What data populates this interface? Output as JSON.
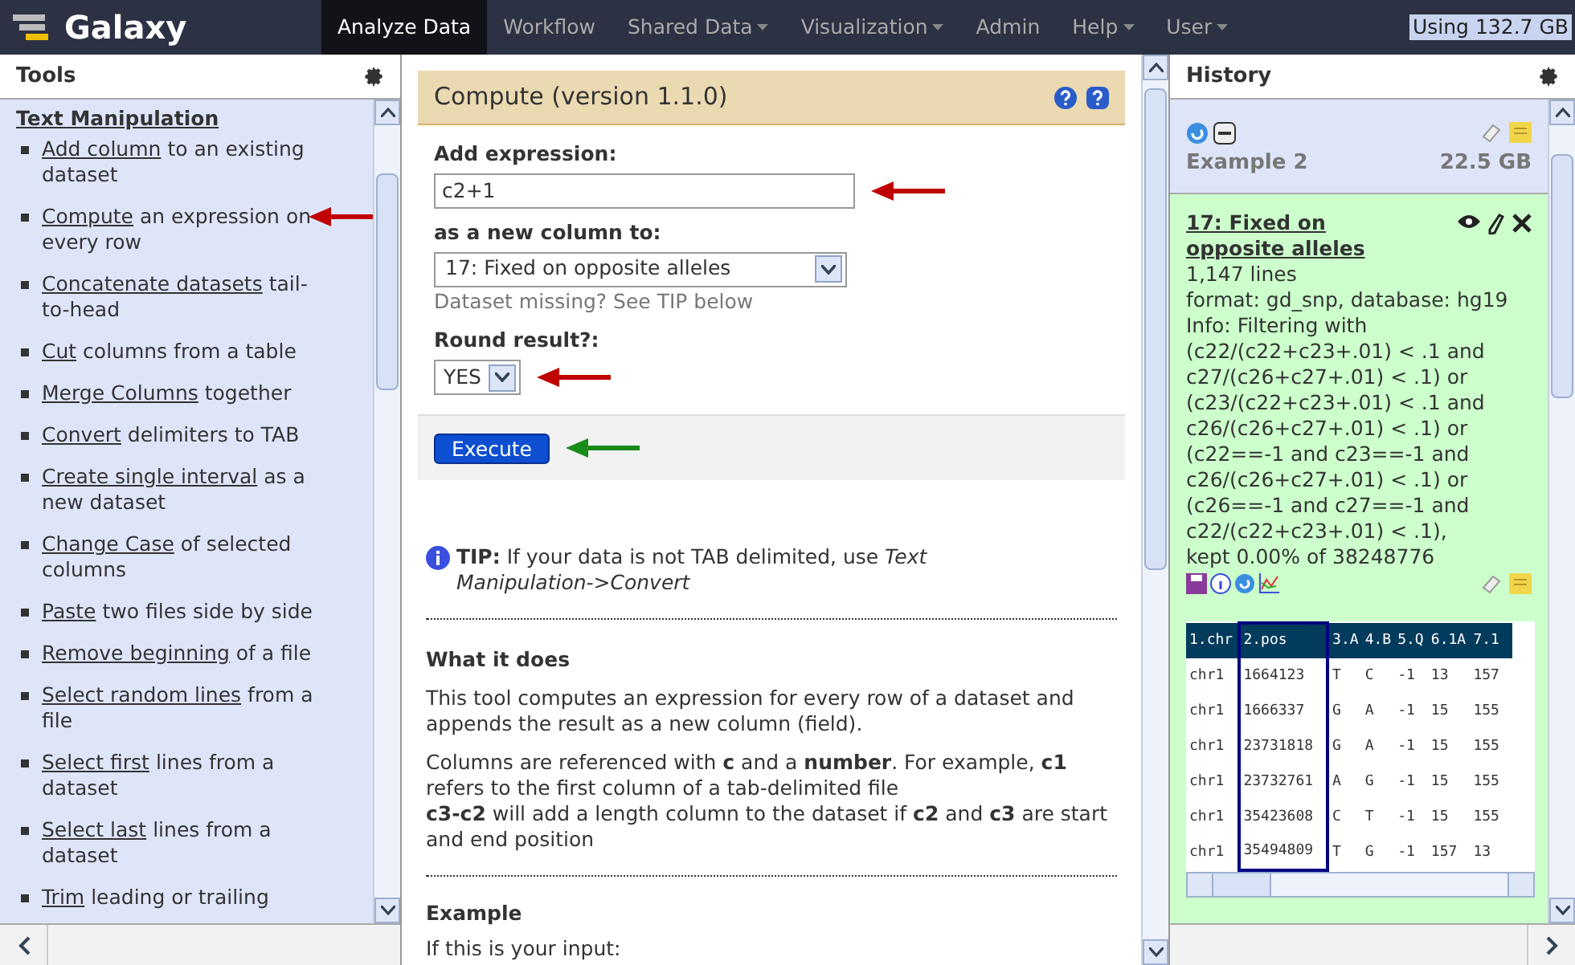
{
  "brand": "Galaxy",
  "nav": [
    {
      "label": "Analyze Data",
      "selected": true,
      "dropdown": false
    },
    {
      "label": "Workflow",
      "selected": false,
      "dropdown": false
    },
    {
      "label": "Shared Data",
      "selected": false,
      "dropdown": true
    },
    {
      "label": "Visualization",
      "selected": false,
      "dropdown": true
    },
    {
      "label": "Admin",
      "selected": false,
      "dropdown": false
    },
    {
      "label": "Help",
      "selected": false,
      "dropdown": true
    },
    {
      "label": "User",
      "selected": false,
      "dropdown": true
    }
  ],
  "usage": "Using 132.7 GB",
  "tools": {
    "title": "Tools",
    "section": "Text Manipulation",
    "items": [
      {
        "link": "Add column",
        "rest": "to an existing dataset",
        "arrow": false
      },
      {
        "link": "Compute",
        "rest": "an expression on every row",
        "arrow": true
      },
      {
        "link": "Concatenate datasets",
        "rest": "tail-to-head",
        "arrow": false
      },
      {
        "link": "Cut",
        "rest": "columns from a table",
        "arrow": false
      },
      {
        "link": "Merge Columns",
        "rest": "together",
        "arrow": false
      },
      {
        "link": "Convert",
        "rest": "delimiters to TAB",
        "arrow": false
      },
      {
        "link": "Create single interval",
        "rest": "as a new dataset",
        "arrow": false
      },
      {
        "link": "Change Case",
        "rest": "of selected columns",
        "arrow": false
      },
      {
        "link": "Paste",
        "rest": "two files side by side",
        "arrow": false
      },
      {
        "link": "Remove beginning",
        "rest": "of a file",
        "arrow": false
      },
      {
        "link": "Select random lines",
        "rest": "from a file",
        "arrow": false
      },
      {
        "link": "Select first",
        "rest": "lines from a dataset",
        "arrow": false
      },
      {
        "link": "Select last",
        "rest": "lines from a dataset",
        "arrow": false
      },
      {
        "link": "Trim",
        "rest": "leading or trailing",
        "arrow": false
      }
    ]
  },
  "tool_form": {
    "title": "Compute (version 1.1.0)",
    "fields": [
      {
        "kind": "text",
        "label": "Add expression:",
        "value": "c2+1",
        "arrow": true
      },
      {
        "kind": "select",
        "label": "as a new column to:",
        "value": "17: Fixed on opposite alleles",
        "help": "Dataset missing? See TIP below",
        "arrow": false
      },
      {
        "kind": "select_small",
        "label": "Round result?:",
        "value": "YES",
        "arrow": true
      }
    ],
    "execute": "Execute",
    "tip": "**TIP:** If your data is not TAB delimited, use *Text Manipulation->Convert*",
    "what_heading": "What it does",
    "paragraphs": [
      [
        "This tool computes an expression for every row of a dataset and appends the result as a new column (field)."
      ],
      [
        "Columns are referenced with **c** and a **number**. For example, **c1** refers to the first column of a tab-delimited file",
        "**c3-c2** will add a length column to the dataset if **c2** and **c3** are start and end position"
      ]
    ],
    "example_heading": "Example",
    "example_text": "If this is your input:"
  },
  "history": {
    "title": "History",
    "name": "Example 2",
    "size": "22.5 GB",
    "dataset": {
      "title": "17: Fixed on opposite alleles",
      "lines": "1,147 lines",
      "format": "format: gd_snp, database: hg19",
      "info": [
        "Info: Filtering with",
        "(c22/(c22+c23+.01) < .1 and",
        "c27/(c26+c27+.01) < .1) or",
        "(c23/(c22+c23+.01) < .1 and",
        "c26/(c26+c27+.01) < .1) or",
        "(c22==-1 and c23==-1 and",
        "c26/(c26+c27+.01) < .1) or",
        "(c26==-1 and c27==-1 and",
        "c22/(c22+c23+.01) < .1),",
        "kept 0.00% of 38248776"
      ],
      "columns": [
        {
          "label": "1.chr",
          "selected": false
        },
        {
          "label": "2.pos",
          "selected": true
        },
        {
          "label": "3.A",
          "selected": false
        },
        {
          "label": "4.B",
          "selected": false
        },
        {
          "label": "5.Q",
          "selected": false
        },
        {
          "label": "6.1A",
          "selected": false
        },
        {
          "label": "7.1",
          "selected": false
        }
      ],
      "rows": [
        [
          "chr1",
          "1664123",
          "T",
          "C",
          "-1",
          "13",
          "157"
        ],
        [
          "chr1",
          "1666337",
          "G",
          "A",
          "-1",
          "15",
          "155"
        ],
        [
          "chr1",
          "23731818",
          "G",
          "A",
          "-1",
          "15",
          "155"
        ],
        [
          "chr1",
          "23732761",
          "A",
          "G",
          "-1",
          "15",
          "155"
        ],
        [
          "chr1",
          "35423608",
          "C",
          "T",
          "-1",
          "15",
          "155"
        ],
        [
          "chr1",
          "35494809",
          "T",
          "G",
          "-1",
          "157",
          "13"
        ]
      ]
    }
  }
}
